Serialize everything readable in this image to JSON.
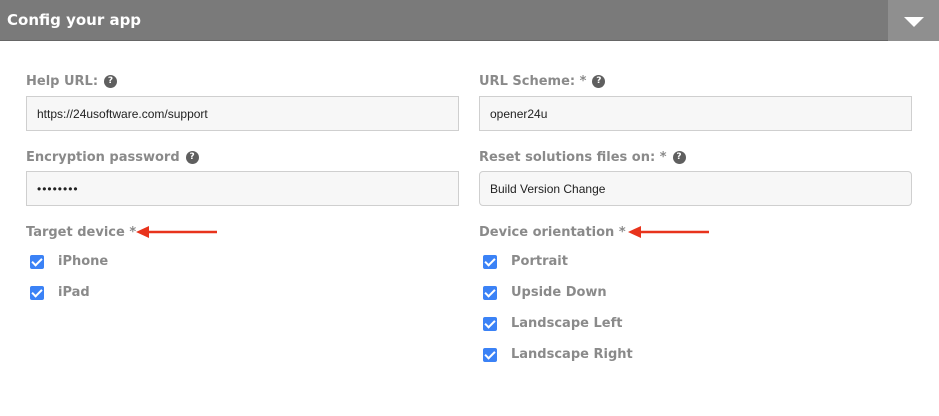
{
  "header": {
    "title": "Config your app",
    "toggle_icon": "triangle-down-icon"
  },
  "form": {
    "help_url": {
      "label": "Help URL:",
      "value": "https://24usoftware.com/support"
    },
    "url_scheme": {
      "label": "URL Scheme: *",
      "value": "opener24u"
    },
    "encryption_password": {
      "label": "Encryption password",
      "value": "••••••••"
    },
    "reset_solutions": {
      "label": "Reset solutions files on: *",
      "value": "Build Version Change"
    },
    "help_icon_glyph": "?"
  },
  "target_device": {
    "label": "Target device *",
    "options": [
      {
        "label": "iPhone",
        "checked": true
      },
      {
        "label": "iPad",
        "checked": true
      }
    ]
  },
  "device_orientation": {
    "label": "Device orientation *",
    "options": [
      {
        "label": "Portrait",
        "checked": true
      },
      {
        "label": "Upside Down",
        "checked": true
      },
      {
        "label": "Landscape Left",
        "checked": true
      },
      {
        "label": "Landscape Right",
        "checked": true
      }
    ]
  },
  "colors": {
    "header_bg": "#7a7a7a",
    "checkbox": "#3b82f6",
    "annotation_arrow": "#e8331c"
  }
}
